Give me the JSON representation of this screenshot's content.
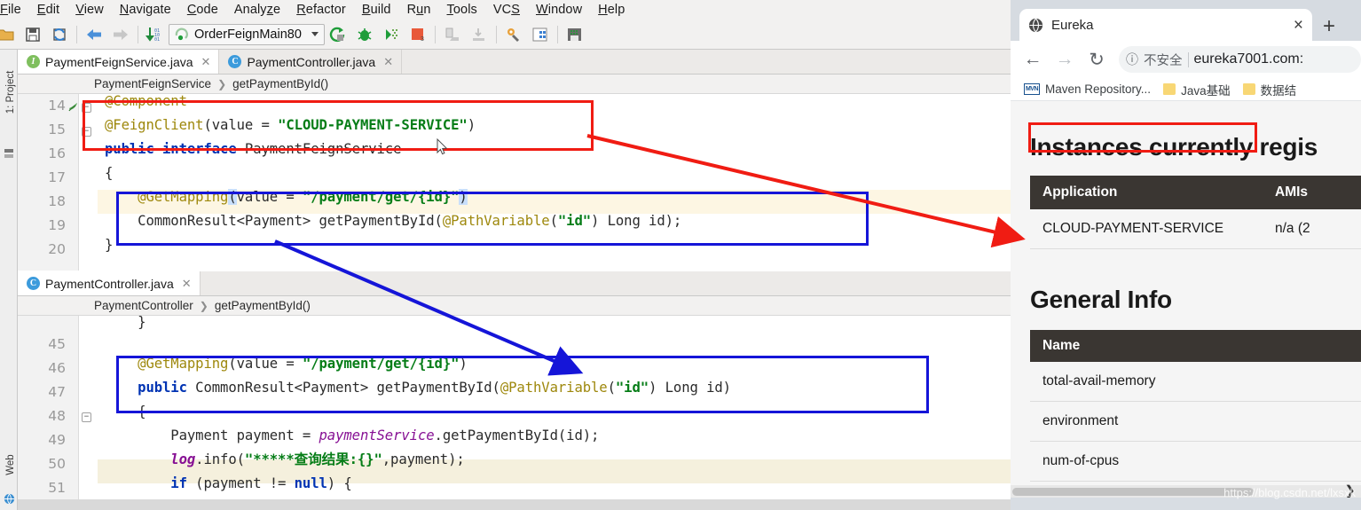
{
  "ide": {
    "menu": [
      {
        "label": "File",
        "mnemonic": "F"
      },
      {
        "label": "Edit",
        "mnemonic": "E"
      },
      {
        "label": "View",
        "mnemonic": "V"
      },
      {
        "label": "Navigate",
        "mnemonic": "N"
      },
      {
        "label": "Code",
        "mnemonic": "C"
      },
      {
        "label": "Analyze",
        "mnemonic": "z"
      },
      {
        "label": "Refactor",
        "mnemonic": "R"
      },
      {
        "label": "Build",
        "mnemonic": "B"
      },
      {
        "label": "Run",
        "mnemonic": "u"
      },
      {
        "label": "Tools",
        "mnemonic": "T"
      },
      {
        "label": "VCS",
        "mnemonic": "S"
      },
      {
        "label": "Window",
        "mnemonic": "W"
      },
      {
        "label": "Help",
        "mnemonic": "H"
      }
    ],
    "toolbar": {
      "run_configuration": "OrderFeignMain80",
      "icons": [
        "open-folder-icon",
        "save-all-icon",
        "sync-icon",
        "back-icon",
        "forward-icon",
        "compile-icon",
        "run-icon",
        "debug-icon",
        "run-coverage-icon",
        "stop-icon",
        "update-project-icon",
        "commit-icon",
        "settings-icon",
        "project-structure-icon",
        "database-icon"
      ]
    },
    "toolwindows": {
      "left_top": "1: Project",
      "left_bottom": "Web"
    },
    "editor1": {
      "tabs": [
        {
          "label": "PaymentFeignService.java",
          "icon": "interface-icon",
          "active": true
        },
        {
          "label": "PaymentController.java",
          "icon": "class-icon",
          "active": false
        }
      ],
      "breadcrumb": [
        "PaymentFeignService",
        "getPaymentById()"
      ],
      "line_numbers": [
        "14",
        "15",
        "16",
        "17",
        "18",
        "19",
        "20"
      ],
      "lines": [
        "@Component",
        "@FeignClient(value = \"CLOUD-PAYMENT-SERVICE\")",
        "public interface PaymentFeignService",
        "{",
        "    @GetMapping(value = \"/payment/get/{id}\")",
        "    CommonResult<Payment> getPaymentById(@PathVariable(\"id\") Long id);",
        "}"
      ],
      "highlight_line": "18"
    },
    "editor2": {
      "tabs": [
        {
          "label": "PaymentController.java",
          "icon": "class-icon",
          "active": true
        }
      ],
      "breadcrumb": [
        "PaymentController",
        "getPaymentById()"
      ],
      "line_numbers": [
        "45",
        "46",
        "47",
        "48",
        "49",
        "50",
        "51"
      ],
      "lines": [
        "",
        "    @GetMapping(value = \"/payment/get/{id}\")",
        "    public CommonResult<Payment> getPaymentById(@PathVariable(\"id\") Long id)",
        "    {",
        "        Payment payment = paymentService.getPaymentById(id);",
        "        log.info(\"*****查询结果:{}\",payment);",
        "        if (payment != null) {"
      ],
      "highlight_line": "50"
    },
    "annotations": {
      "red_box_1": "@FeignClient annotation block",
      "red_box_2": "CLOUD-PAYMENT-SERVICE registry entry",
      "blue_box_1": "interface method signature",
      "blue_box_2": "controller method signature",
      "red_arrow_color": "#f01c13",
      "blue_arrow_color": "#1515d8"
    }
  },
  "browser": {
    "tab": {
      "title": "Eureka",
      "favicon": "globe-icon",
      "close_label": "×"
    },
    "new_tab_label": "+",
    "nav": {
      "back": "←",
      "forward": "→",
      "reload": "↻",
      "security_label": "不安全",
      "url": "eureka7001.com:"
    },
    "bookmarks": [
      {
        "label": "Maven Repository...",
        "icon": "mvn-icon"
      },
      {
        "label": "Java基础",
        "icon": "folder-icon"
      },
      {
        "label": "数据结",
        "icon": "folder-icon"
      }
    ],
    "page": {
      "heading_instances": "Instances currently regis",
      "instances_table": {
        "headers": [
          "Application",
          "AMIs"
        ],
        "rows": [
          {
            "application": "CLOUD-PAYMENT-SERVICE",
            "amis": "n/a (2"
          }
        ]
      },
      "heading_general": "General Info",
      "general_table": {
        "headers": [
          "Name"
        ],
        "rows": [
          "total-avail-memory",
          "environment",
          "num-of-cpus"
        ]
      }
    },
    "watermark": "https://blog.csdn.net/lxsxk",
    "scroll_chevron": "❯"
  }
}
